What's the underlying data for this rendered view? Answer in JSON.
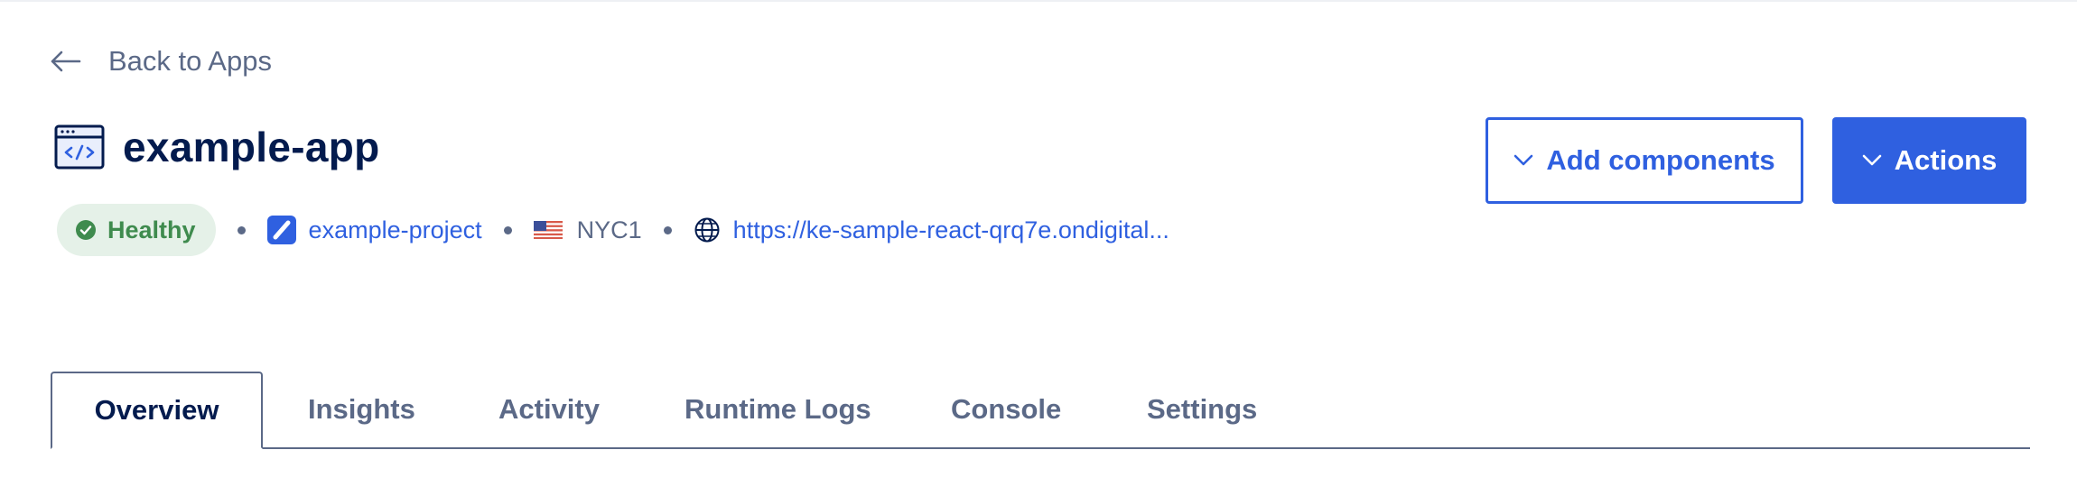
{
  "nav": {
    "back_label": "Back to Apps"
  },
  "app": {
    "title": "example-app",
    "status": "Healthy",
    "project": "example-project",
    "region": "NYC1",
    "url": "https://ke-sample-react-qrq7e.ondigital..."
  },
  "actions": {
    "add_components_label": "Add components",
    "actions_label": "Actions"
  },
  "tabs": [
    {
      "label": "Overview",
      "active": true
    },
    {
      "label": "Insights"
    },
    {
      "label": "Activity"
    },
    {
      "label": "Runtime Logs"
    },
    {
      "label": "Console"
    },
    {
      "label": "Settings"
    }
  ],
  "icons": {
    "back": "arrow-left-icon",
    "app": "code-window-icon",
    "status": "check-circle-icon",
    "project": "project-icon",
    "region": "us-flag-icon",
    "url": "globe-icon",
    "dropdown": "chevron-down-icon"
  },
  "colors": {
    "primary": "#2f60e0",
    "heading": "#031b4e",
    "muted": "#5b6987",
    "healthy_bg": "#e5f1e8",
    "healthy_text": "#3f8b4e"
  }
}
